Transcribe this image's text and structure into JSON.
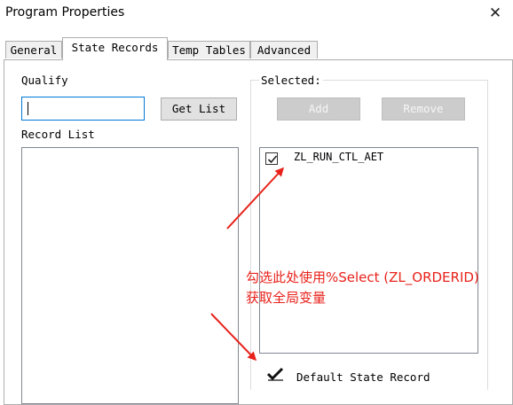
{
  "window": {
    "title": "Program Properties",
    "close_glyph": "✕"
  },
  "tabs": [
    {
      "label": "General",
      "active": false
    },
    {
      "label": "State Records",
      "active": true
    },
    {
      "label": "Temp Tables",
      "active": false
    },
    {
      "label": "Advanced",
      "active": false
    }
  ],
  "qualify": {
    "label": "Qualify",
    "value": ""
  },
  "get_list_button": "Get List",
  "record_list": {
    "label": "Record List",
    "items": []
  },
  "selected": {
    "label": "Selected:",
    "add_button": "Add",
    "remove_button": "Remove",
    "items": [
      {
        "label": "ZL_RUN_CTL_AET",
        "checked": true
      }
    ]
  },
  "default_state_record": {
    "label": "Default State Record",
    "checked": true
  },
  "annotation": {
    "line1": "勾选此处使用%Select (ZL_ORDERID)",
    "line2": "获取全局变量",
    "color": "#e8221b"
  }
}
